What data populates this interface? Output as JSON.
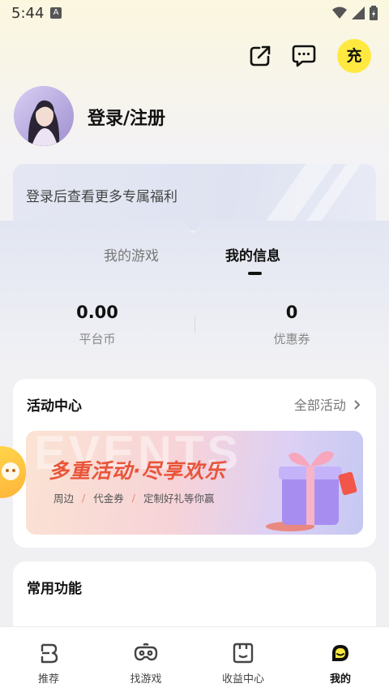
{
  "status_bar": {
    "time": "5:44",
    "indicator": "A"
  },
  "header": {
    "share_icon": "share-icon",
    "message_icon": "message-icon",
    "charge_label": "充"
  },
  "profile": {
    "login_label": "登录/注册"
  },
  "benefit": {
    "text": "登录后查看更多专属福利"
  },
  "tabs": [
    {
      "label": "我的游戏",
      "active": false
    },
    {
      "label": "我的信息",
      "active": true
    }
  ],
  "stats": [
    {
      "value": "0.00",
      "label": "平台币"
    },
    {
      "value": "0",
      "label": "优惠券"
    }
  ],
  "activity": {
    "title": "活动中心",
    "all_label": "全部活动",
    "banner": {
      "watermark": "EVENTS",
      "title": "多重活动·尽享欢乐",
      "subtitle_items": [
        "周边",
        "代金券",
        "定制好礼等你赢"
      ]
    }
  },
  "common": {
    "title": "常用功能"
  },
  "bottom_nav": [
    {
      "label": "推荐",
      "icon": "recommend-icon",
      "active": false
    },
    {
      "label": "找游戏",
      "icon": "gamepad-icon",
      "active": false
    },
    {
      "label": "收益中心",
      "icon": "earnings-icon",
      "active": false
    },
    {
      "label": "我的",
      "icon": "profile-smile-icon",
      "active": true
    }
  ],
  "colors": {
    "accent_yellow": "#ffe940",
    "banner_title": "#e8553a"
  }
}
